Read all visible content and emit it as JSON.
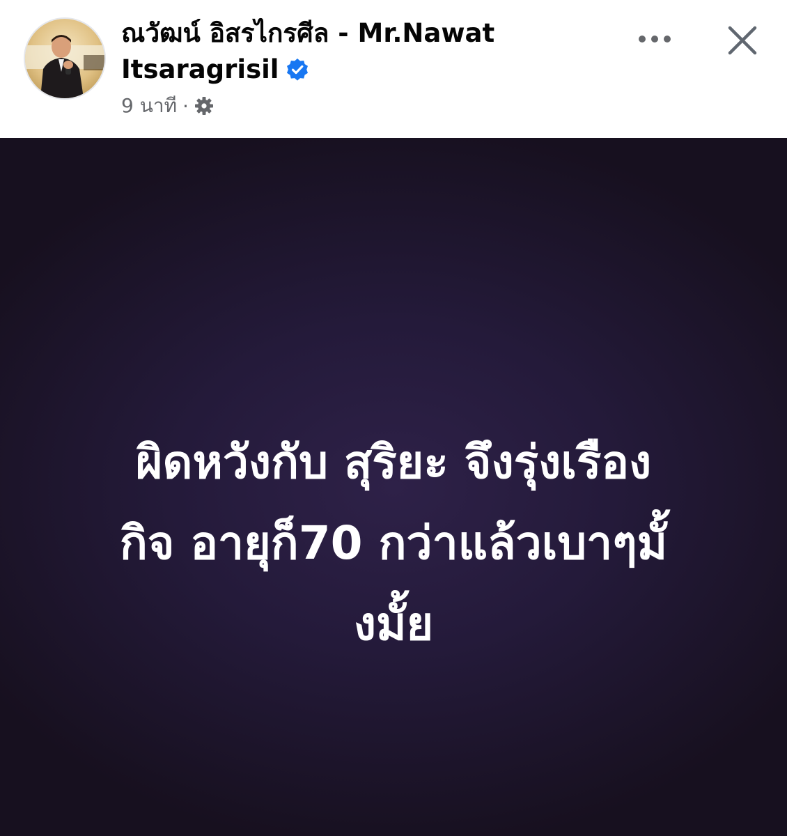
{
  "post": {
    "author_name": "ณวัฒน์ อิสรไกรศีล - Mr.Nawat Itsaragrisil",
    "verified": true,
    "timestamp": "9 นาที",
    "separator": "·",
    "privacy_icon": "gear-icon",
    "text_lines": [
      "ผิดหวังกับ สุริยะ จึงรุ่งเรือง",
      "กิจ อายุก็70 กว่าแล้วเบาๆมั้",
      "งมั้ย"
    ],
    "background_color": "#1c1426",
    "text_color": "#ffffff"
  },
  "header": {
    "more_icon": "more-horizontal-icon",
    "close_icon": "close-icon"
  },
  "colors": {
    "verified_blue": "#1877f2",
    "meta_gray": "#65676b",
    "name_black": "#050505"
  }
}
